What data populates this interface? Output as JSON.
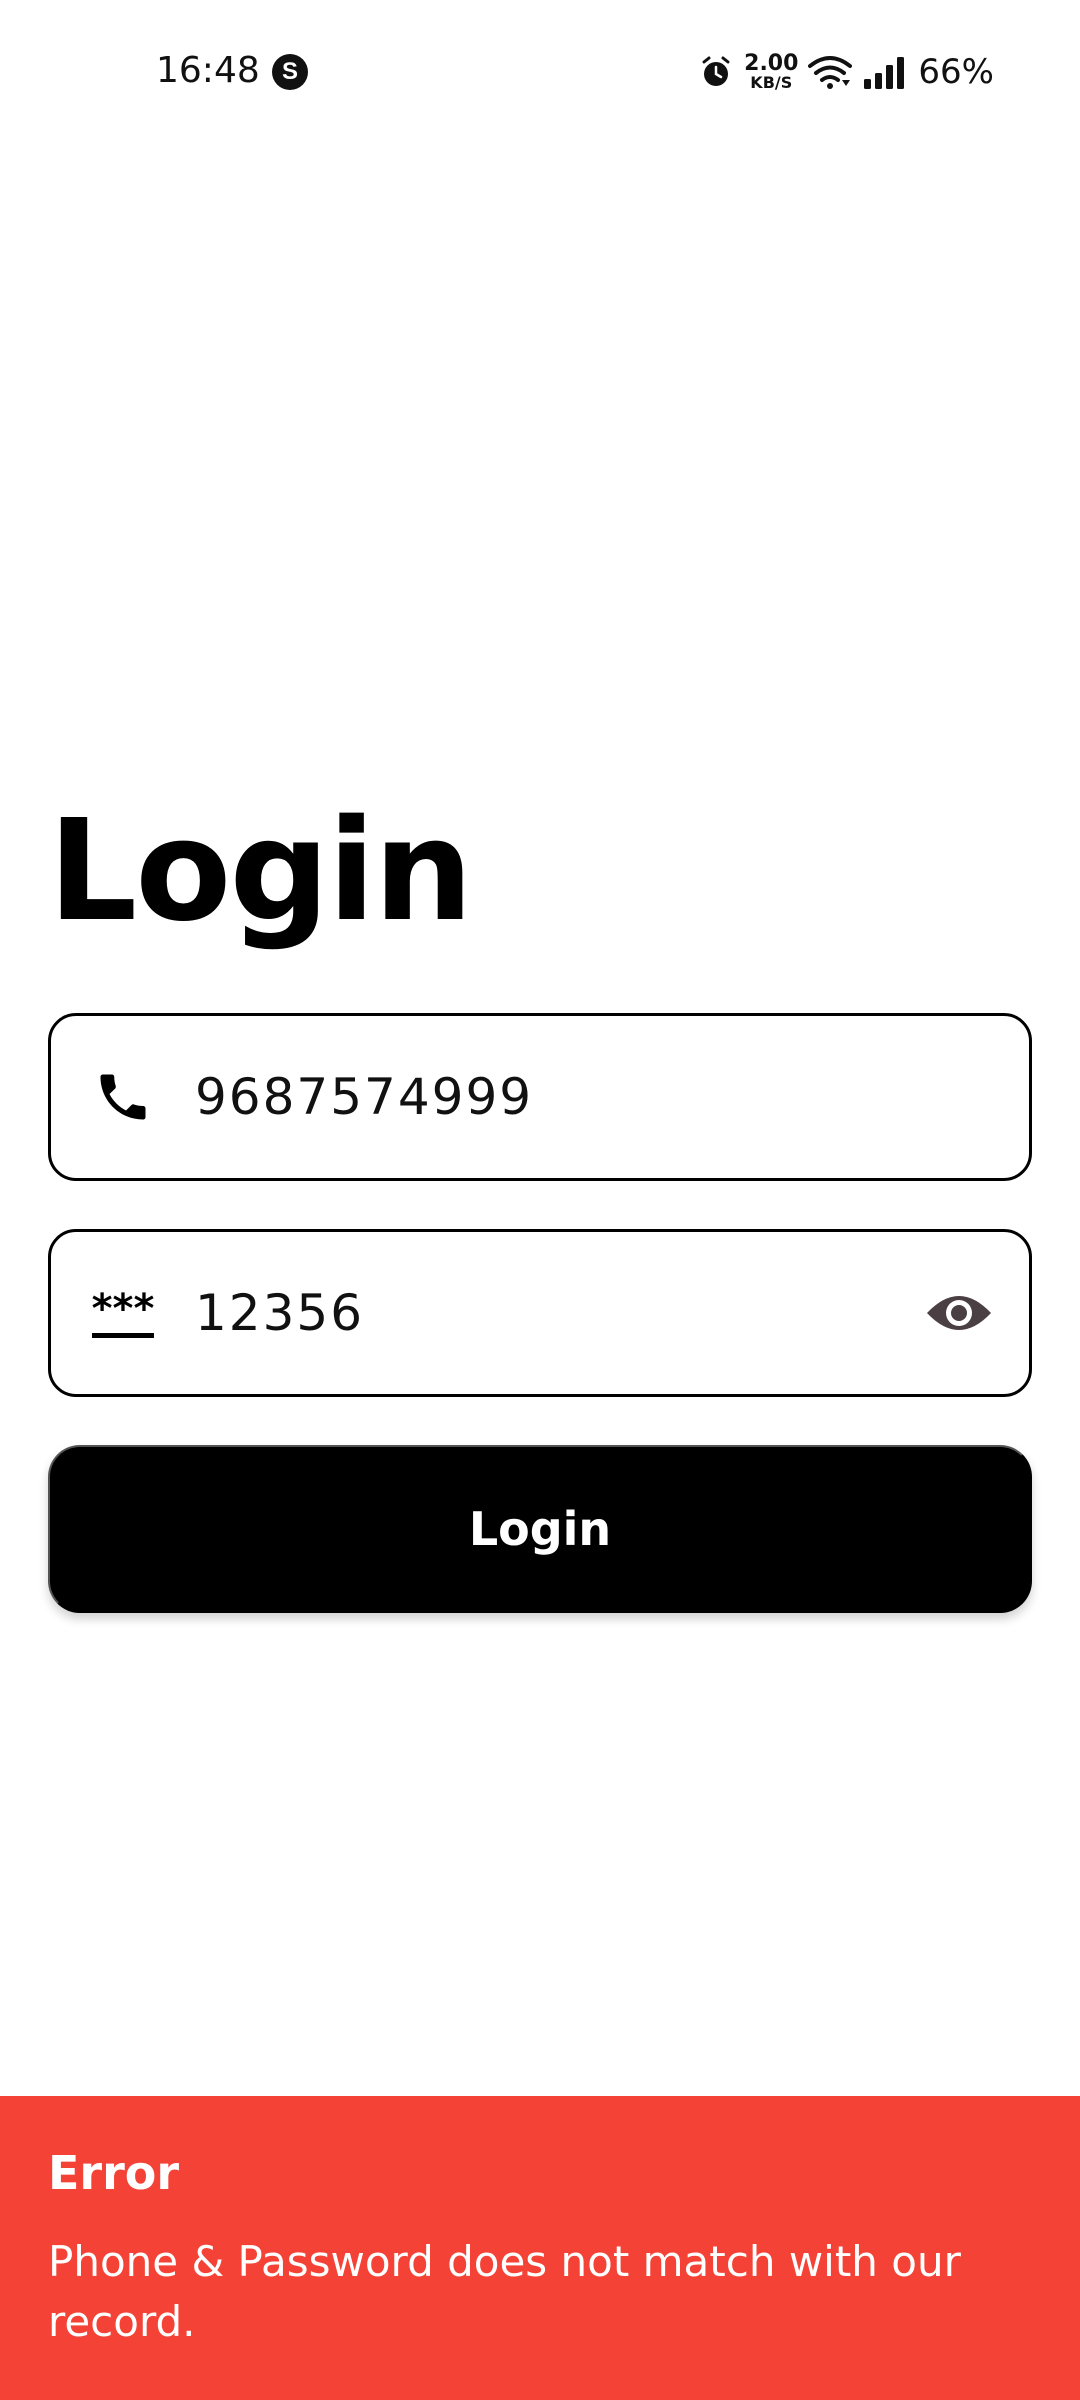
{
  "status_bar": {
    "time": "16:48",
    "net_speed_value": "2.00",
    "net_speed_unit": "KB/S",
    "battery": "66%",
    "icons": [
      "skype-icon",
      "alarm-icon",
      "wifi-icon",
      "signal-icon"
    ]
  },
  "login_form": {
    "title": "Login",
    "phone_value": "9687574999",
    "password_value": "12356",
    "password_icon_text": "***",
    "submit_label": "Login"
  },
  "error": {
    "title": "Error",
    "message": "Phone & Password does not match with our record.",
    "color": "#f44336"
  }
}
